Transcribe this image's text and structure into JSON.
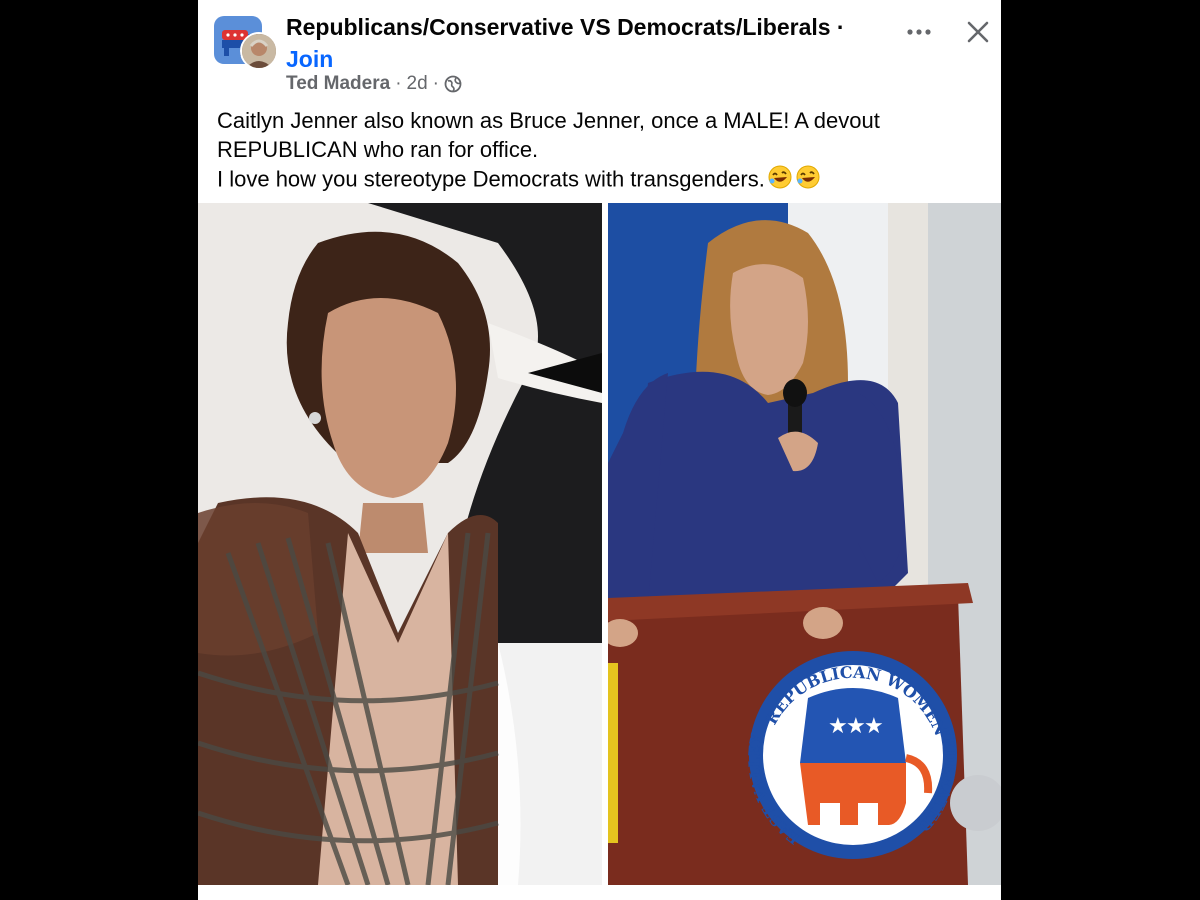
{
  "post": {
    "group_name": "Republicans/Conservative VS Democrats/Liberals ·",
    "join_label": "Join",
    "author": "Ted Madera",
    "separator": "·",
    "time": "2d",
    "separator2": "·",
    "privacy_icon": "globe-icon",
    "text_lines": [
      "Caitlyn Jenner also known as Bruce Jenner, once a MALE!  A devout",
      "REPUBLICAN who ran for office.",
      "I love how you stereotype Democrats with transgenders."
    ],
    "emojis": [
      "rolling-on-floor-laughing-emoji",
      "rolling-on-floor-laughing-emoji"
    ]
  },
  "photos": {
    "right": {
      "podium_seal_top": "REPUBLICAN WOMEN",
      "podium_seal_left": "EAST VALLEY",
      "podium_seal_right": "FEDERATED"
    }
  },
  "colors": {
    "link_blue": "#0866ff",
    "meta_gray": "#65676b",
    "text_dark": "#050505",
    "background": "#000000"
  }
}
